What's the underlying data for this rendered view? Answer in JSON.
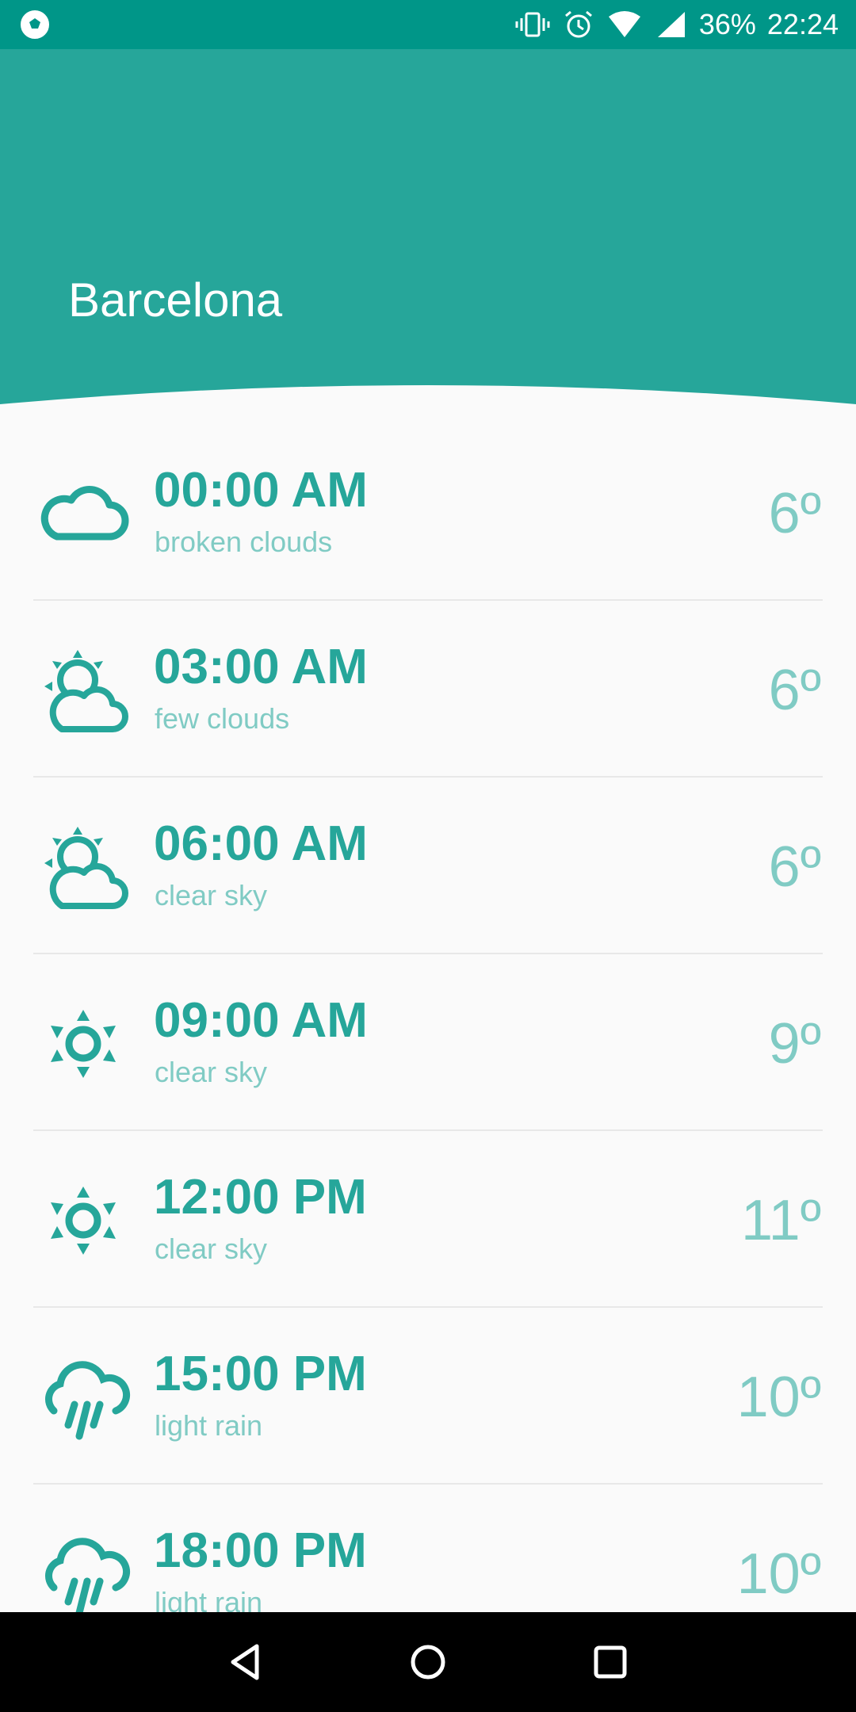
{
  "status_bar": {
    "battery": "36%",
    "time": "22:24",
    "icons": [
      "soccer-ball-icon",
      "vibrate-icon",
      "alarm-icon",
      "wifi-icon",
      "signal-icon"
    ]
  },
  "header": {
    "city": "Barcelona"
  },
  "forecast": [
    {
      "time": "00:00 AM",
      "description": "broken clouds",
      "temp": "6º",
      "icon": "cloud-icon"
    },
    {
      "time": "03:00 AM",
      "description": "few clouds",
      "temp": "6º",
      "icon": "sun-behind-cloud-icon"
    },
    {
      "time": "06:00 AM",
      "description": "clear sky",
      "temp": "6º",
      "icon": "sun-behind-cloud-icon"
    },
    {
      "time": "09:00 AM",
      "description": "clear sky",
      "temp": "9º",
      "icon": "sun-icon"
    },
    {
      "time": "12:00 PM",
      "description": "clear sky",
      "temp": "11º",
      "icon": "sun-icon"
    },
    {
      "time": "15:00 PM",
      "description": "light rain",
      "temp": "10º",
      "icon": "rain-icon"
    },
    {
      "time": "18:00 PM",
      "description": "light rain",
      "temp": "10º",
      "icon": "rain-icon"
    }
  ],
  "colors": {
    "status_bar": "#009688",
    "header": "#26a69a",
    "accent_text": "#26a69a",
    "secondary_text": "#80cbc4",
    "background": "#fafafa"
  },
  "navigation": [
    "back-icon",
    "home-icon",
    "recents-icon"
  ]
}
